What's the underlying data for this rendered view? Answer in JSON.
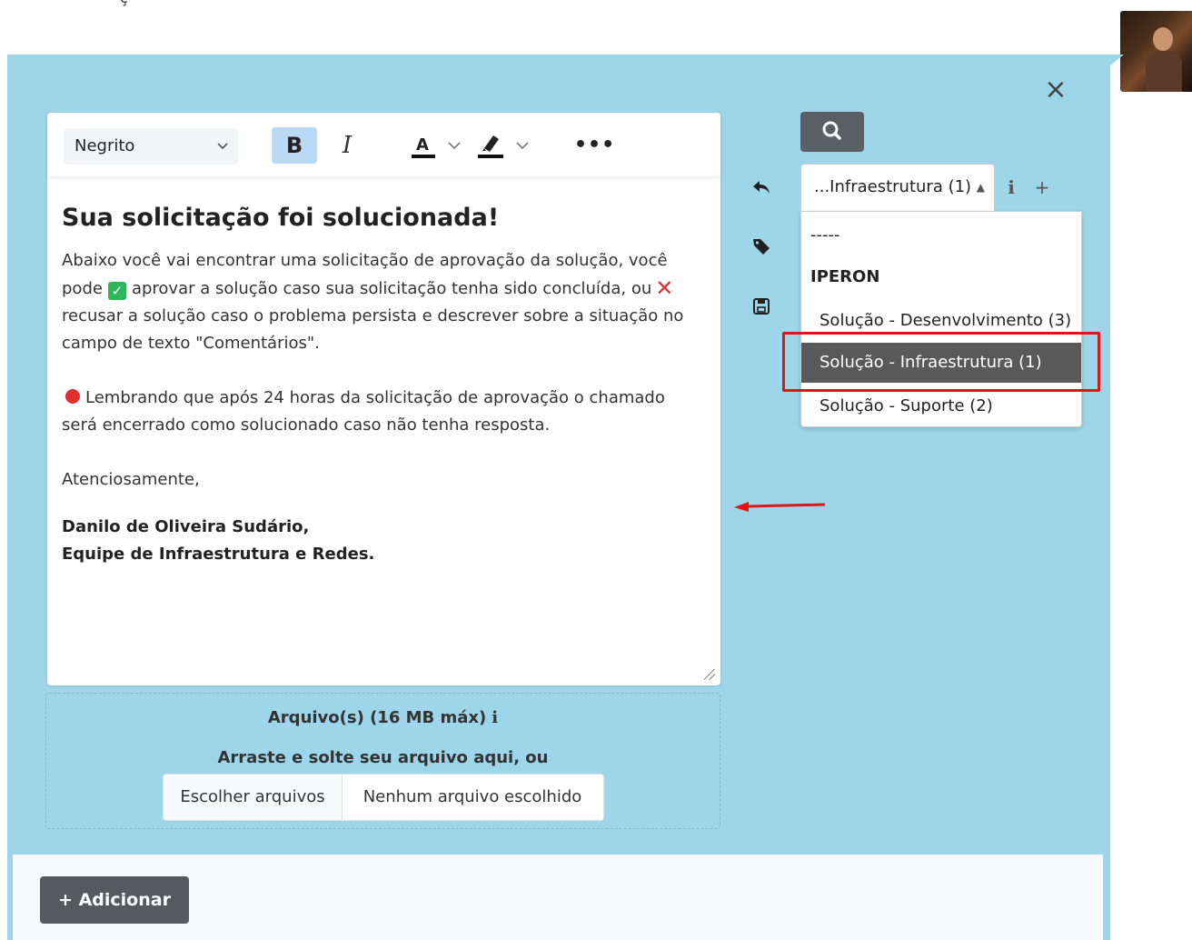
{
  "top_fragment": "ç",
  "editor": {
    "style_select": "Negrito",
    "bold_label": "B",
    "italic_label": "I",
    "font_color_label": "A",
    "more_label": "•••",
    "heading": "Sua solicitação foi solucionada!",
    "p1_part1": "Abaixo você vai encontrar uma solicitação de aprovação da solução, você pode",
    "p1_part2": "aprovar a solução caso sua solicitação tenha sido concluída, ou",
    "p1_part3": "recusar a solução caso o problema persista e descrever sobre a situação no campo de texto \"Comentários\".",
    "p2": "Lembrando que após 24 horas da solicitação de aprovação o chamado será encerrado como solucionado caso não tenha resposta.",
    "p3": "Atenciosamente,",
    "sig_line1": "Danilo de Oliveira Sudário,",
    "sig_line2": "Equipe de Infraestrutura e Redes."
  },
  "upload": {
    "title": "Arquivo(s) (16 MB máx)",
    "info": "i",
    "drop_text": "Arraste e solte seu arquivo aqui, ou",
    "choose_label": "Escolher arquivos",
    "no_file_label": "Nenhum arquivo escolhido"
  },
  "template_select": {
    "value": "...Infraestrutura (1)",
    "info": "i",
    "plus": "+",
    "options": {
      "blank": "-----",
      "group": "IPERON",
      "items": [
        "Solução - Desenvolvimento (3)",
        "Solução - Infraestrutura (1)",
        "Solução - Suporte (2)"
      ],
      "selected": "Solução - Infraestrutura (1)"
    }
  },
  "close_label": "×",
  "footer": {
    "add_label": "+ Adicionar"
  },
  "colors": {
    "panel": "#9dd5ea",
    "selected_bg": "#595959",
    "highlight": "#e01414",
    "button_dark": "#555a5e"
  },
  "icons": [
    "search-icon",
    "reply-icon",
    "tag-icon",
    "save-icon",
    "close-icon",
    "chevron-down-icon",
    "arrow-left-icon"
  ]
}
